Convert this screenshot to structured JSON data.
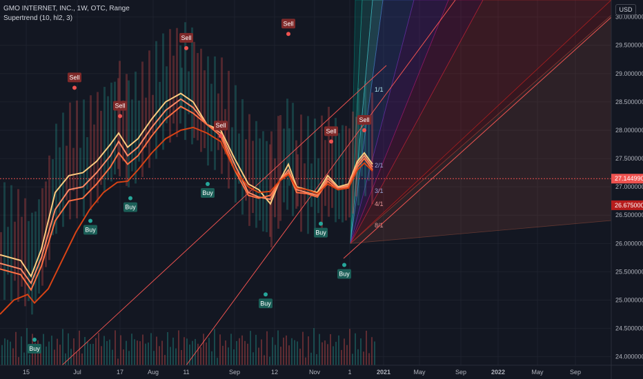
{
  "legend": {
    "symbol": "GMO INTERNET, INC., 1W, OTC, Range",
    "indicator": "Supertrend (10, hl2, 3)"
  },
  "currency": "USD",
  "colors": {
    "background": "#131722",
    "grid": "#1e222d",
    "up": "#26a69a",
    "down": "#ef5350"
  },
  "chart_data": {
    "type": "line",
    "y_axis": {
      "range": [
        23.85,
        30.3
      ],
      "ticks": [
        "24.000000",
        "24.500000",
        "25.000000",
        "25.500000",
        "26.000000",
        "26.500000",
        "27.000000",
        "27.500000",
        "28.000000",
        "28.500000",
        "29.000000",
        "29.500000",
        "30.000000"
      ],
      "tick_values": [
        24.0,
        24.5,
        25.0,
        25.5,
        26.0,
        26.5,
        27.0,
        27.5,
        28.0,
        28.5,
        29.0,
        29.5,
        30.0
      ]
    },
    "x_axis": {
      "ticks": [
        "15",
        "Jul",
        "17",
        "Aug",
        "11",
        "Sep",
        "12",
        "Nov",
        "1",
        "2021",
        "May",
        "Sep",
        "2022",
        "May",
        "Sep"
      ],
      "tick_index": [
        38,
        112,
        174,
        222,
        270,
        340,
        398,
        456,
        507,
        556,
        608,
        668,
        722,
        779,
        834
      ]
    },
    "price_labels": [
      {
        "value": 27.14499,
        "text": "27.144990"
      },
      {
        "value": 26.675,
        "text": "26.675000"
      }
    ],
    "signals": [
      {
        "type": "Buy",
        "x": 50,
        "price": 24.3
      },
      {
        "type": "Buy",
        "x": 131,
        "price": 26.4
      },
      {
        "type": "Buy",
        "x": 189,
        "price": 26.8
      },
      {
        "type": "Buy",
        "x": 301,
        "price": 27.05
      },
      {
        "type": "Buy",
        "x": 385,
        "price": 25.1
      },
      {
        "type": "Buy",
        "x": 465,
        "price": 26.35
      },
      {
        "type": "Buy",
        "x": 499,
        "price": 25.62
      },
      {
        "type": "Sell",
        "x": 108,
        "price": 28.75
      },
      {
        "type": "Sell",
        "x": 174,
        "price": 28.25
      },
      {
        "type": "Sell",
        "x": 270,
        "price": 29.45
      },
      {
        "type": "Sell",
        "x": 320,
        "price": 27.9
      },
      {
        "type": "Sell",
        "x": 418,
        "price": 29.7
      },
      {
        "type": "Sell",
        "x": 480,
        "price": 27.8
      },
      {
        "type": "Sell",
        "x": 528,
        "price": 28.0
      }
    ],
    "gann_fan_labels": [
      {
        "text": "1/1",
        "price": 28.72
      },
      {
        "text": "2/1",
        "price": 27.38
      },
      {
        "text": "3/1",
        "price": 26.93
      },
      {
        "text": "4/1",
        "price": 26.7
      },
      {
        "text": "8/1",
        "price": 26.32
      }
    ],
    "series": [
      {
        "color": "#ffcc80",
        "points": [
          [
            0,
            25.8
          ],
          [
            30,
            25.7
          ],
          [
            45,
            25.42
          ],
          [
            60,
            25.9
          ],
          [
            80,
            26.9
          ],
          [
            100,
            27.2
          ],
          [
            120,
            27.25
          ],
          [
            140,
            27.45
          ],
          [
            160,
            27.75
          ],
          [
            172,
            27.95
          ],
          [
            185,
            27.7
          ],
          [
            200,
            27.85
          ],
          [
            220,
            28.2
          ],
          [
            240,
            28.5
          ],
          [
            262,
            28.65
          ],
          [
            280,
            28.5
          ],
          [
            300,
            28.1
          ],
          [
            320,
            28.0
          ],
          [
            340,
            27.5
          ],
          [
            360,
            27.05
          ],
          [
            375,
            26.95
          ],
          [
            392,
            26.7
          ],
          [
            405,
            27.1
          ],
          [
            418,
            27.4
          ],
          [
            430,
            27.0
          ],
          [
            445,
            26.95
          ],
          [
            460,
            26.9
          ],
          [
            475,
            27.2
          ],
          [
            490,
            27.0
          ],
          [
            505,
            27.05
          ],
          [
            518,
            27.45
          ],
          [
            528,
            27.6
          ],
          [
            540,
            27.4
          ]
        ]
      },
      {
        "color": "#ff8a65",
        "points": [
          [
            0,
            25.65
          ],
          [
            30,
            25.55
          ],
          [
            45,
            25.3
          ],
          [
            60,
            25.75
          ],
          [
            80,
            26.6
          ],
          [
            100,
            26.95
          ],
          [
            120,
            27.0
          ],
          [
            140,
            27.25
          ],
          [
            160,
            27.55
          ],
          [
            172,
            27.8
          ],
          [
            185,
            27.55
          ],
          [
            200,
            27.7
          ],
          [
            220,
            28.05
          ],
          [
            240,
            28.35
          ],
          [
            262,
            28.55
          ],
          [
            280,
            28.4
          ],
          [
            300,
            28.1
          ],
          [
            320,
            27.95
          ],
          [
            340,
            27.4
          ],
          [
            360,
            26.9
          ],
          [
            375,
            26.82
          ],
          [
            392,
            26.78
          ],
          [
            405,
            27.1
          ],
          [
            418,
            27.3
          ],
          [
            430,
            26.95
          ],
          [
            445,
            26.9
          ],
          [
            460,
            26.85
          ],
          [
            475,
            27.15
          ],
          [
            490,
            26.98
          ],
          [
            505,
            27.02
          ],
          [
            518,
            27.4
          ],
          [
            528,
            27.55
          ],
          [
            540,
            27.35
          ]
        ]
      },
      {
        "color": "#ff7043",
        "points": [
          [
            0,
            25.55
          ],
          [
            30,
            25.45
          ],
          [
            45,
            25.18
          ],
          [
            60,
            25.6
          ],
          [
            80,
            26.4
          ],
          [
            100,
            26.75
          ],
          [
            120,
            26.8
          ],
          [
            140,
            27.05
          ],
          [
            160,
            27.35
          ],
          [
            172,
            27.6
          ],
          [
            185,
            27.4
          ],
          [
            200,
            27.55
          ],
          [
            220,
            27.9
          ],
          [
            240,
            28.2
          ],
          [
            262,
            28.42
          ],
          [
            280,
            28.3
          ],
          [
            300,
            28.1
          ],
          [
            320,
            27.9
          ],
          [
            340,
            27.3
          ],
          [
            360,
            26.85
          ],
          [
            375,
            26.8
          ],
          [
            392,
            26.85
          ],
          [
            405,
            27.1
          ],
          [
            418,
            27.25
          ],
          [
            430,
            26.9
          ],
          [
            445,
            26.88
          ],
          [
            460,
            26.82
          ],
          [
            475,
            27.1
          ],
          [
            490,
            26.95
          ],
          [
            505,
            27.0
          ],
          [
            518,
            27.35
          ],
          [
            528,
            27.5
          ],
          [
            540,
            27.3
          ]
        ]
      },
      {
        "color": "#d84315",
        "points": [
          [
            0,
            24.75
          ],
          [
            20,
            25.0
          ],
          [
            40,
            25.1
          ],
          [
            50,
            24.95
          ],
          [
            70,
            25.2
          ],
          [
            90,
            25.7
          ],
          [
            110,
            26.2
          ],
          [
            130,
            26.6
          ],
          [
            150,
            26.9
          ],
          [
            170,
            27.08
          ],
          [
            185,
            27.1
          ],
          [
            200,
            27.3
          ],
          [
            220,
            27.6
          ],
          [
            240,
            27.85
          ],
          [
            262,
            28.0
          ],
          [
            280,
            28.05
          ],
          [
            300,
            27.95
          ],
          [
            320,
            27.8
          ],
          [
            340,
            27.3
          ],
          [
            360,
            27.0
          ],
          [
            375,
            26.9
          ],
          [
            392,
            26.92
          ],
          [
            405,
            27.1
          ],
          [
            418,
            27.22
          ],
          [
            430,
            26.98
          ],
          [
            445,
            26.95
          ],
          [
            460,
            26.88
          ],
          [
            475,
            27.05
          ],
          [
            490,
            26.95
          ],
          [
            505,
            26.98
          ],
          [
            518,
            27.3
          ],
          [
            528,
            27.42
          ],
          [
            540,
            27.28
          ]
        ]
      }
    ]
  }
}
